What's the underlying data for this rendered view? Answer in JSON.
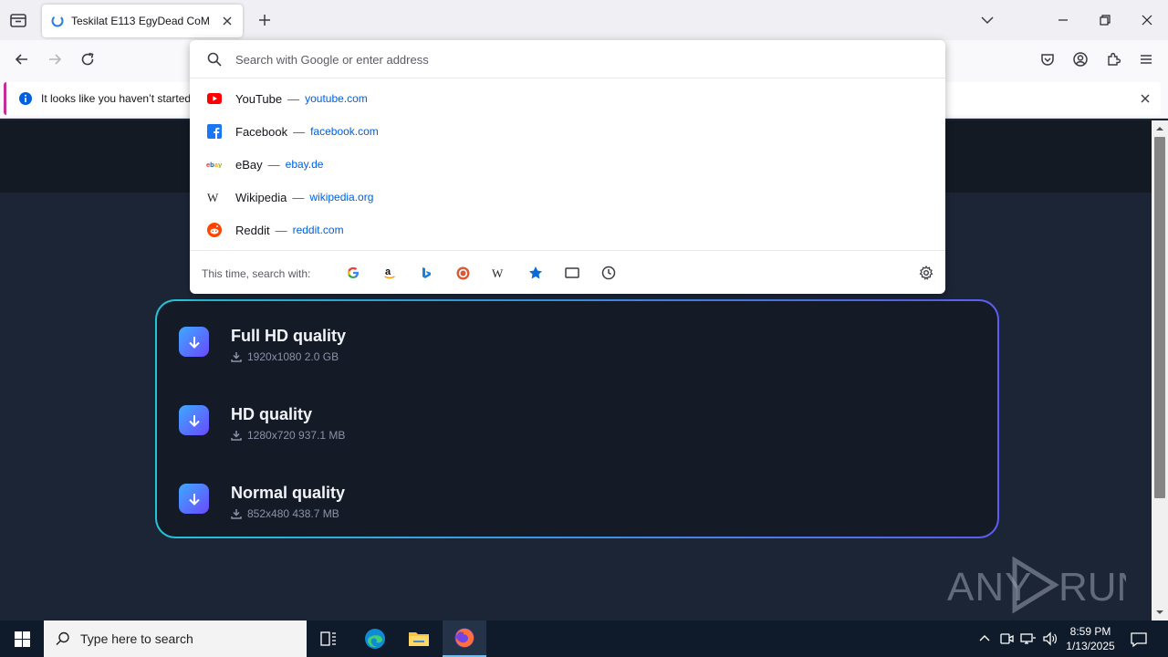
{
  "browser": {
    "tab": {
      "title": "Teskilat E113 EgyDead CoM"
    },
    "notification": {
      "message": "It looks like you haven’t started"
    }
  },
  "urlbar": {
    "placeholder": "Search with Google or enter address",
    "suggestions": [
      {
        "name": "YouTube",
        "url": "youtube.com",
        "icon": "youtube-icon"
      },
      {
        "name": "Facebook",
        "url": "facebook.com",
        "icon": "facebook-icon"
      },
      {
        "name": "eBay",
        "url": "ebay.de",
        "icon": "ebay-icon"
      },
      {
        "name": "Wikipedia",
        "url": "wikipedia.org",
        "icon": "wikipedia-icon"
      },
      {
        "name": "Reddit",
        "url": "reddit.com",
        "icon": "reddit-icon"
      }
    ],
    "dash": "—",
    "search_with_label": "This time, search with:",
    "engines": [
      "google-icon",
      "amazon-icon",
      "bing-icon",
      "duckduckgo-icon",
      "wikipedia-icon",
      "bookmarks-star-icon",
      "tabs-icon",
      "history-icon"
    ]
  },
  "downloads": [
    {
      "title": "Full HD quality",
      "meta": "1920x1080 2.0 GB"
    },
    {
      "title": "HD quality",
      "meta": "1280x720 937.1 MB"
    },
    {
      "title": "Normal quality",
      "meta": "852x480 438.7 MB"
    }
  ],
  "watermark": {
    "text": "ANY RUN"
  },
  "taskbar": {
    "search_placeholder": "Type here to search",
    "time": "8:59 PM",
    "date": "1/13/2025"
  },
  "colors": {
    "accent_cyan": "#22c4d6",
    "accent_violet": "#5b5ef0",
    "link_blue": "#0061e0",
    "notification_bar": "#c62d9b"
  }
}
